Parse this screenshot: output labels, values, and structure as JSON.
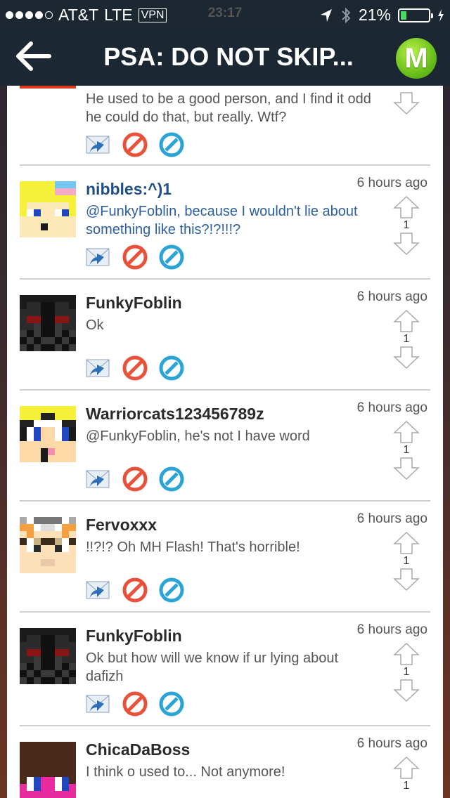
{
  "status_bar": {
    "carrier": "AT&T",
    "network": "LTE",
    "vpn": "VPN",
    "time": "23:17",
    "battery": "21%",
    "battery_level": 0.21,
    "signal_bars": 4
  },
  "nav": {
    "title": "PSA: DO NOT SKIP...",
    "logo_letter": "M",
    "back_icon": "arrow-left-icon"
  },
  "colors": {
    "nav_bg": "#1b2733",
    "username_blue": "#1f4f86",
    "reply_blue": "#2b5f9e",
    "logo_green": "#6abf1a",
    "block_red": "#e8513a",
    "report_blue": "#2aa3d6"
  },
  "partial_post": {
    "text": "He used to be a good person, and I find it odd he could do that, but really. Wtf?"
  },
  "posts": [
    {
      "username": "nibbles:^)1",
      "time": "6 hours ago",
      "text": "@FunkyFoblin, because I wouldn't lie about something like this?!?!!!?",
      "votes": "1",
      "highlight": true
    },
    {
      "username": "FunkyFoblin",
      "time": "6 hours ago",
      "text": "Ok",
      "votes": "1",
      "highlight": false
    },
    {
      "username": "Warriorcats123456789z",
      "time": "6 hours ago",
      "text": "@FunkyFoblin, he's not I have word",
      "votes": "1",
      "highlight": false
    },
    {
      "username": "Fervoxxx",
      "time": "6 hours ago",
      "text": "!!?!? Oh MH Flash! That's horrible!",
      "votes": "1",
      "highlight": false
    },
    {
      "username": "FunkyFoblin",
      "time": "6 hours ago",
      "text": "Ok but how will we know if ur lying about dafizh",
      "votes": "1",
      "highlight": false
    },
    {
      "username": "ChicaDaBoss",
      "time": "6 hours ago",
      "text": "I think o used to... Not anymore!",
      "votes": "1",
      "highlight": false
    }
  ],
  "icons": {
    "reply": "reply-envelope-icon",
    "block": "block-icon",
    "report": "report-icon",
    "upvote": "upvote-arrow-icon",
    "downvote": "downvote-arrow-icon"
  }
}
